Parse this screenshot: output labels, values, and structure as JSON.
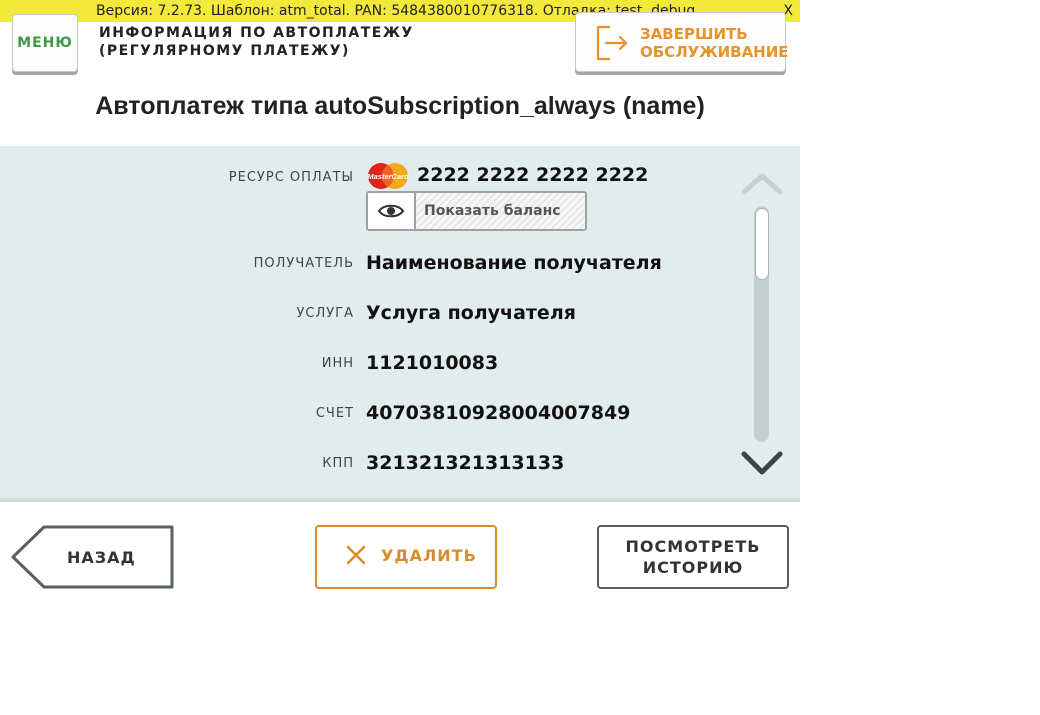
{
  "debug": {
    "text": "Версия: 7.2.73. Шаблон: atm_total. PAN: 5484380010776318. Отладка: test, debug.",
    "close_label": "X"
  },
  "header": {
    "menu_label": "МЕНЮ",
    "title_line1": "ИНФОРМАЦИЯ ПО АВТОПЛАТЕЖУ",
    "title_line2": "(РЕГУЛЯРНОМУ ПЛАТЕЖУ)",
    "finish_line1": "ЗАВЕРШИТЬ",
    "finish_line2": "ОБСЛУЖИВАНИЕ"
  },
  "page_title": "Автоплатеж типа autoSubscription_always (name)",
  "details": {
    "resource_label": "РЕСУРС ОПЛАТЫ",
    "card_number": "2222 2222 2222 2222",
    "card_brand": "MasterCard",
    "balance_button": "Показать баланс",
    "rows": [
      {
        "label": "ПОЛУЧАТЕЛЬ",
        "value": "Наименование получателя"
      },
      {
        "label": "УСЛУГА",
        "value": "Услуга получателя"
      },
      {
        "label": "ИНН",
        "value": "1121010083"
      },
      {
        "label": "СЧЕТ",
        "value": "40703810928004007849"
      },
      {
        "label": "КПП",
        "value": "321321321313133"
      }
    ]
  },
  "buttons": {
    "back": "НАЗАД",
    "delete": "УДАЛИТЬ",
    "history_line1": "ПОСМОТРЕТЬ",
    "history_line2": "ИСТОРИЮ"
  },
  "colors": {
    "debug_bar": "#f3e93a",
    "menu_text": "#3d9b45",
    "accent_orange": "#e8922a",
    "panel_bg": "#e1ecec"
  },
  "icons": {
    "finish": "exit-door-icon",
    "eye": "eye-icon",
    "delete": "close-x-icon",
    "scroll_up": "chevron-up-icon",
    "scroll_down": "chevron-down-icon",
    "card": "mastercard-logo"
  }
}
